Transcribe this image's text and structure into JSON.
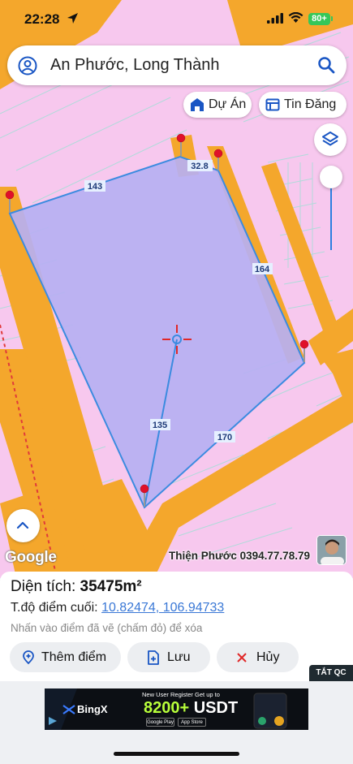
{
  "status_bar": {
    "time": "22:28",
    "battery": "80+"
  },
  "search": {
    "text": "An Phước, Long Thành"
  },
  "chips": {
    "du_an": "Dự Án",
    "tin_dang": "Tin Đăng"
  },
  "map": {
    "edge_labels": [
      "143",
      "32.8",
      "164",
      "170",
      "135"
    ],
    "google_label": "Google",
    "watermark": "Thiện Phước 0394.77.78.79"
  },
  "panel": {
    "area_label": "Diện tích:",
    "area_value": "35475m²",
    "coord_label": "T.độ điểm cuối:",
    "coord_value": "10.82474, 106.94733",
    "hint": "Nhấn vào điểm đã vẽ (chấm đỏ) để xóa",
    "add_point": "Thêm điểm",
    "save": "Lưu",
    "cancel": "Hủy"
  },
  "ad": {
    "close_label": "TẮT QC",
    "brand": "BingX",
    "headline": "New User Register Get up to",
    "amount": "8200+",
    "currency": "USDT",
    "google_play": "Google Play",
    "app_store": "App Store"
  },
  "colors": {
    "map_bg": "#f7c8ee",
    "road": "#f4a72c",
    "parcel_fill": "#b6b0f2",
    "parcel_stroke": "#3b8be0",
    "pin": "#e0102a",
    "link": "#3a78d6"
  }
}
